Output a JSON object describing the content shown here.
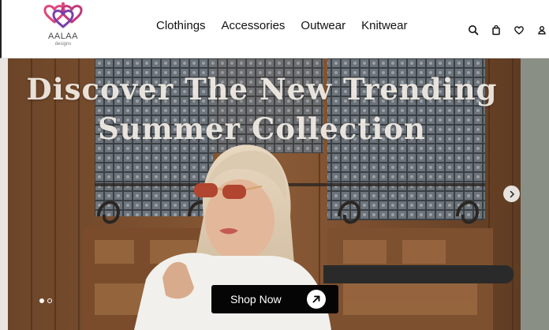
{
  "brand": {
    "name": "AALAA",
    "tagline": "designs",
    "logo_icon": "triple-heart-logo",
    "colors": {
      "rose": "#d9447a",
      "violet": "#7a3fa8"
    }
  },
  "nav": {
    "items": [
      {
        "label": "Clothings"
      },
      {
        "label": "Accessories"
      },
      {
        "label": "Outwear"
      },
      {
        "label": "Knitwear"
      }
    ]
  },
  "header_icons": [
    {
      "name": "search-icon"
    },
    {
      "name": "shopping-bag-icon"
    },
    {
      "name": "heart-icon"
    },
    {
      "name": "user-icon"
    }
  ],
  "hero": {
    "title_line1": "Discover The New Trending",
    "title_line2": "Summer Collection",
    "cta_label": "Shop Now",
    "cta_icon": "arrow-up-right-icon",
    "next_icon": "chevron-right-icon",
    "slides": {
      "total": 2,
      "active": 1
    }
  }
}
